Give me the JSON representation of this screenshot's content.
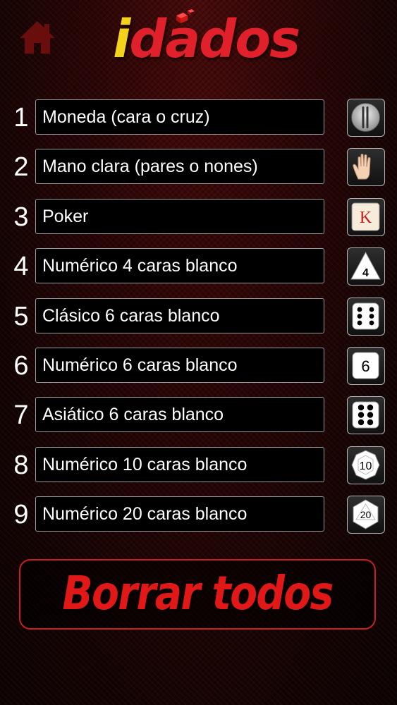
{
  "header": {
    "logo_i": "i",
    "logo_rest": "dados",
    "colors": {
      "logo_i": "#f2d21a",
      "logo_text": "#e0202a",
      "home_icon": "#6a0d0d"
    }
  },
  "dice_list": [
    {
      "number": "1",
      "name": "Moneda (cara o cruz)",
      "icon": "coin-icon"
    },
    {
      "number": "2",
      "name": "Mano clara (pares o nones)",
      "icon": "hand-icon"
    },
    {
      "number": "3",
      "name": "Poker",
      "icon": "poker-k-icon",
      "icon_text": "K"
    },
    {
      "number": "4",
      "name": "Numérico 4 caras blanco",
      "icon": "d4-icon",
      "icon_text": "4"
    },
    {
      "number": "5",
      "name": "Clásico 6 caras blanco",
      "icon": "d6-pips-icon"
    },
    {
      "number": "6",
      "name": "Numérico 6 caras blanco",
      "icon": "d6-number-icon",
      "icon_text": "6"
    },
    {
      "number": "7",
      "name": "Asiático 6 caras blanco",
      "icon": "d6-asian-icon"
    },
    {
      "number": "8",
      "name": "Numérico 10 caras blanco",
      "icon": "d10-icon",
      "icon_text": "10"
    },
    {
      "number": "9",
      "name": "Numérico 20 caras blanco",
      "icon": "d20-icon",
      "icon_text": "20"
    }
  ],
  "clear_button": {
    "label": "Borrar todos",
    "color": "#e01818"
  }
}
